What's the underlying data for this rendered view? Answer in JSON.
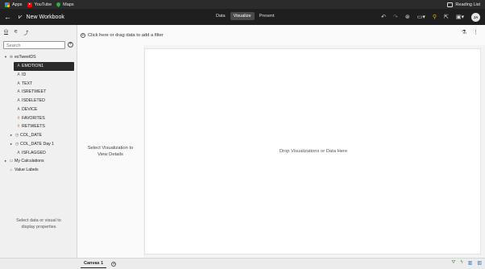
{
  "bookmarks": {
    "items": [
      {
        "label": "Apps",
        "icon": "apps-grid-icon"
      },
      {
        "label": "YouTube",
        "icon": "youtube-icon"
      },
      {
        "label": "Maps",
        "icon": "maps-icon"
      }
    ],
    "reading_list": "Reading List"
  },
  "header": {
    "title": "New Workbook",
    "modes": [
      "Data",
      "Visualize",
      "Present"
    ],
    "active_mode": "Visualize",
    "avatar": "JA"
  },
  "left_panel": {
    "search_placeholder": "Search",
    "datasource": "esTweetDS",
    "columns": [
      {
        "label": "EMOTION1",
        "type": "attribute",
        "selected": true
      },
      {
        "label": "ID",
        "type": "attribute"
      },
      {
        "label": "TEXT",
        "type": "attribute"
      },
      {
        "label": "ISRETWEET",
        "type": "attribute"
      },
      {
        "label": "ISDELETED",
        "type": "attribute"
      },
      {
        "label": "DEVICE",
        "type": "attribute"
      },
      {
        "label": "FAVORITES",
        "type": "measure"
      },
      {
        "label": "RETWEETS",
        "type": "measure"
      },
      {
        "label": "COL_DATE",
        "type": "date",
        "expandable": true
      },
      {
        "label": "COL_DATE Day 1",
        "type": "date",
        "expandable": true
      },
      {
        "label": "ISFLAGGED",
        "type": "attribute"
      }
    ],
    "my_calculations": "My Calculations",
    "value_labels": "Value Labels",
    "properties_hint_1": "Select data or visual to",
    "properties_hint_2": "display properties"
  },
  "middle_panel": {
    "hint_1": "Select Visualization to",
    "hint_2": "View Details"
  },
  "filter_bar": {
    "label": "Click here or drag data to add a filter"
  },
  "canvas": {
    "drop_text": "Drop Visualizations or Data Here",
    "tab_label": "Canvas 1"
  }
}
